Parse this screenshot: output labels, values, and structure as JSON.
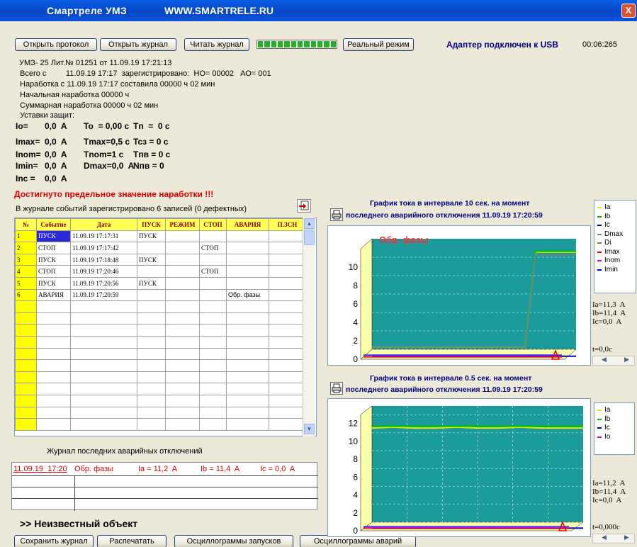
{
  "window": {
    "title": "Смартреле  УМЗ",
    "url": "WWW.SMARTRELE.RU",
    "close_label": "X"
  },
  "toolbar": {
    "open_protocol": "Открыть протокол",
    "open_journal": "Открыть журнал",
    "read_journal": "Читать журнал",
    "real_mode": "Реальный режим",
    "adapter_status": "Адаптер подключен к USB",
    "time": "00:06:265",
    "progress": 1.0
  },
  "device_info": {
    "line1": "УМЗ- 25 Лит.№ 01251  от 11.09.19  17:21:13",
    "line2": "Всего с         11.09.19 17:17  зарегистрировано:  НО= 00002   АО= 001",
    "line3": "Наработка с 11.09.19 17:17 составила 00000 ч 02  мин",
    "line4": "Начальная наработка  00000 ч",
    "line5": "Суммарная наработка  00000 ч  02  мин",
    "line6": "Уставки защит:"
  },
  "settings": [
    [
      "Io=",
      "0,0  A",
      "To  = 0,00 c",
      "Tп  =  0 c"
    ],
    [
      "Imax=",
      "0,0  A",
      "Tmax=0,5 c",
      "Tcз = 0 c"
    ],
    [
      "Inom=",
      "0,0  A",
      "Tnom=1 c",
      "Tпв = 0 c"
    ],
    [
      "Imin=",
      "0,0  A",
      "Dmax=0,0  A",
      "Nпв = 0"
    ],
    [
      "Inc =",
      "0,0  A",
      "",
      ""
    ]
  ],
  "warning": "Достигнуто предельное значение наработки !!!",
  "journal": {
    "summary": "В журнале событий зарегистрировано 6 записей (0 дефектных)",
    "headers": [
      "№",
      "Событие",
      "Дата",
      "ПУСК",
      "РЕЖИМ",
      "СТОП",
      "АВАРИЯ",
      "П.ЗСН"
    ],
    "rows": [
      [
        "1",
        "ПУСК",
        "11.09.19  17:17:31",
        "ПУСК",
        "",
        "",
        "",
        ""
      ],
      [
        "2",
        "СТОП",
        "11.09.19  17:17:42",
        "",
        "",
        "СТОП",
        "",
        ""
      ],
      [
        "3",
        "ПУСК",
        "11.09.19  17:18:48",
        "ПУСК",
        "",
        "",
        "",
        ""
      ],
      [
        "4",
        "СТОП",
        "11.09.19  17:20:46",
        "",
        "",
        "СТОП",
        "",
        ""
      ],
      [
        "5",
        "ПУСК",
        "11.09.19  17:20:56",
        "ПУСК",
        "",
        "",
        "",
        ""
      ],
      [
        "6",
        "АВАРИЯ",
        "11.09.19  17:20:59",
        "",
        "",
        "",
        "Обр. фазы",
        ""
      ]
    ],
    "empty_rows": 11
  },
  "last_faults": {
    "title": "Журнал последних аварийных отключений",
    "row": [
      "11.09.19  17:20",
      "Обр. фазы",
      "Ia = 11,2  A",
      "Ib = 11,4  A",
      "Ic = 0,0  A"
    ]
  },
  "object_name": ">> Неизвестный объект",
  "bottom_buttons": {
    "save_journal": "Сохранить журнал",
    "print": "Распечатать",
    "start_osc": "Осциллограммы запусков",
    "fault_osc": "Осциллограммы аварий"
  },
  "chart1": {
    "title1": "График тока в интервале 10 сек. на момент",
    "title2": "последнего аварийного отключения 11.09.19  17:20:59",
    "annotation": "Обр. фазы",
    "legend": [
      {
        "name": "Ia",
        "color": "#e8e800"
      },
      {
        "name": "Ib",
        "color": "#00c000"
      },
      {
        "name": "Ic",
        "color": "#0000c0"
      },
      {
        "name": "Dmax",
        "color": "#808080"
      },
      {
        "name": "Di",
        "color": "#808040"
      },
      {
        "name": "Imax",
        "color": "#e00000"
      },
      {
        "name": "Inom",
        "color": "#e000e0"
      },
      {
        "name": "Imin",
        "color": "#0000ff"
      }
    ],
    "meas": [
      "Ia=11,3  A",
      "Ib=11,4  A",
      "Ic=0,0  A"
    ],
    "t_label": "t=0,0c"
  },
  "chart2": {
    "title1": "График тока в интервале 0.5 сек. на момент",
    "title2": "последнего аварийного отключения 11.09.19  17:20:59",
    "legend": [
      {
        "name": "Ia",
        "color": "#e8e800"
      },
      {
        "name": "Ib",
        "color": "#00c000"
      },
      {
        "name": "Ic",
        "color": "#0000c0"
      },
      {
        "name": "Io",
        "color": "#e000e0"
      }
    ],
    "meas": [
      "Ia=11,2  A",
      "Ib=11,4  A",
      "Ic=0,0  A"
    ],
    "t_label": "t=0,000c"
  },
  "chart_data": [
    {
      "type": "line",
      "title": "График тока в интервале 10 сек. на момент последнего аварийного отключения 11.09.19  17:20:59",
      "ylim": [
        0,
        12
      ],
      "yticks": [
        0,
        2,
        4,
        6,
        8,
        10
      ],
      "x": [
        0,
        1,
        2,
        3,
        4,
        5,
        6,
        7,
        7.5,
        8,
        9,
        10
      ],
      "series": [
        {
          "name": "Ia",
          "values": [
            1,
            1,
            1,
            1,
            1,
            1,
            1,
            1,
            1,
            11.3,
            11.3,
            11.3
          ]
        },
        {
          "name": "Ib",
          "values": [
            1,
            1,
            1,
            1,
            1,
            1,
            1,
            1,
            1,
            11.4,
            11.4,
            11.4
          ]
        },
        {
          "name": "Ic",
          "values": [
            0,
            0,
            0,
            0,
            0,
            0,
            0,
            0,
            0,
            0,
            0,
            0
          ]
        },
        {
          "name": "Dmax",
          "values": [
            1,
            1,
            1,
            1,
            1,
            1,
            1,
            1,
            1,
            11,
            11,
            11
          ]
        }
      ]
    },
    {
      "type": "line",
      "title": "График тока в интервале 0.5 сек. на момент последнего аварийного отключения 11.09.19  17:20:59",
      "ylim": [
        0,
        13
      ],
      "yticks": [
        0,
        2,
        4,
        6,
        8,
        10,
        12
      ],
      "x": [
        0,
        0.05,
        0.1,
        0.15,
        0.2,
        0.25,
        0.3,
        0.35,
        0.4,
        0.45,
        0.5
      ],
      "series": [
        {
          "name": "Ia",
          "values": [
            11.2,
            11.3,
            11.2,
            11.2,
            11.3,
            11.2,
            11.2,
            11.3,
            11.2,
            11.2,
            11.2
          ]
        },
        {
          "name": "Ib",
          "values": [
            11.4,
            11.4,
            11.4,
            11.4,
            11.4,
            11.4,
            11.4,
            11.4,
            11.4,
            11.4,
            11.4
          ]
        },
        {
          "name": "Ic",
          "values": [
            0,
            0,
            0,
            0,
            0,
            0,
            0,
            0,
            0,
            0,
            0
          ]
        }
      ]
    }
  ]
}
